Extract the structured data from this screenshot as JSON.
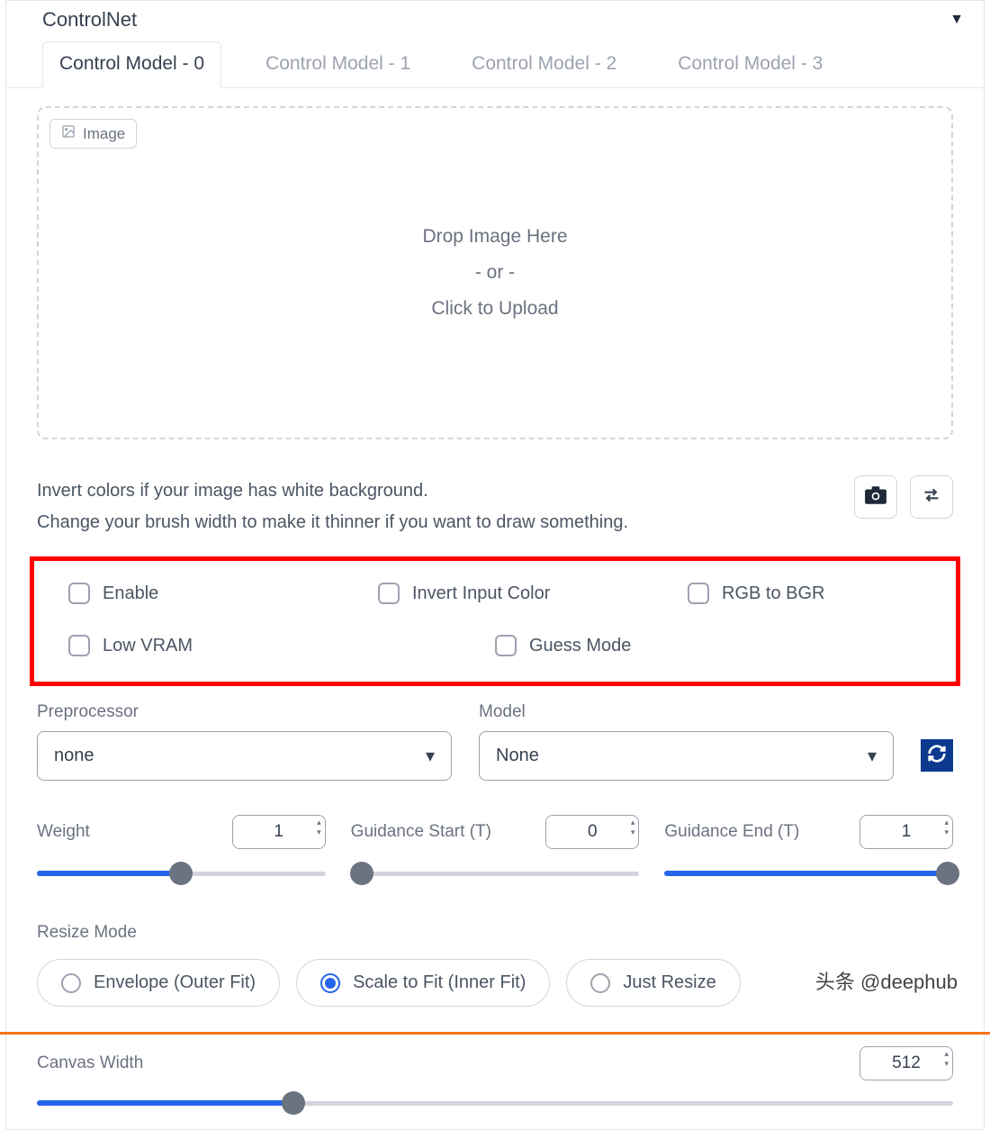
{
  "panel": {
    "title": "ControlNet"
  },
  "tabs": [
    {
      "label": "Control Model - 0",
      "active": true
    },
    {
      "label": "Control Model - 1",
      "active": false
    },
    {
      "label": "Control Model - 2",
      "active": false
    },
    {
      "label": "Control Model - 3",
      "active": false
    }
  ],
  "dropzone": {
    "badge": "Image",
    "line1": "Drop Image Here",
    "line2": "- or -",
    "line3": "Click to Upload"
  },
  "hints": {
    "line1": "Invert colors if your image has white background.",
    "line2": "Change your brush width to make it thinner if you want to draw something."
  },
  "checks": {
    "enable": "Enable",
    "invert": "Invert Input Color",
    "rgb": "RGB to BGR",
    "lowvram": "Low VRAM",
    "guess": "Guess Mode"
  },
  "preprocessor": {
    "label": "Preprocessor",
    "value": "none"
  },
  "model": {
    "label": "Model",
    "value": "None"
  },
  "weight": {
    "label": "Weight",
    "value": "1",
    "fill_pct": 50
  },
  "g_start": {
    "label": "Guidance Start (T)",
    "value": "0",
    "fill_pct": 0
  },
  "g_end": {
    "label": "Guidance End (T)",
    "value": "1",
    "fill_pct": 100
  },
  "resize": {
    "label": "Resize Mode",
    "options": {
      "envelope": "Envelope (Outer Fit)",
      "scale": "Scale to Fit (Inner Fit)",
      "just": "Just Resize"
    },
    "selected": "scale"
  },
  "canvas_width": {
    "label": "Canvas Width",
    "value": "512",
    "fill_pct": 28
  },
  "watermark": "头条 @deephub"
}
